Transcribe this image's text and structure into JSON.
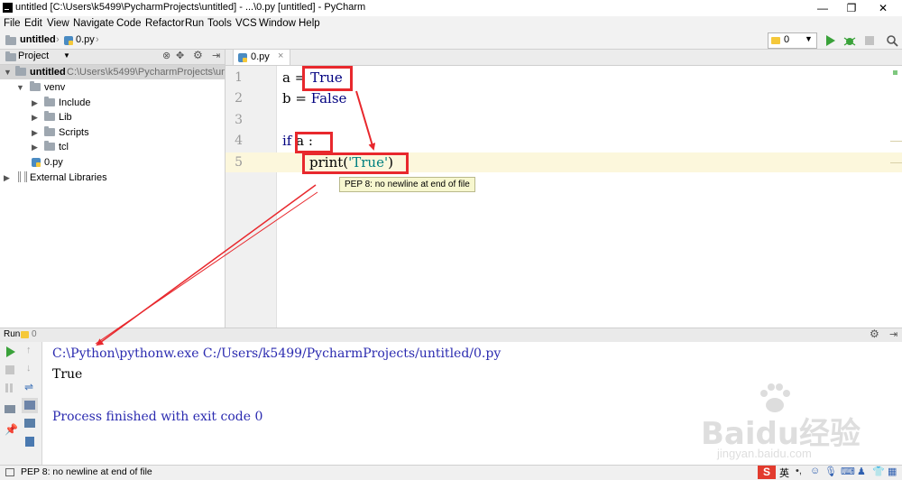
{
  "window": {
    "title": "untitled [C:\\Users\\k5499\\PycharmProjects\\untitled] - ...\\0.py [untitled] - PyCharm",
    "minimize": "—",
    "restore": "❐",
    "close": "✕"
  },
  "menu": [
    "File",
    "Edit",
    "View",
    "Navigate",
    "Code",
    "Refactor",
    "Run",
    "Tools",
    "VCS",
    "Window",
    "Help"
  ],
  "breadcrumb": {
    "project": "untitled",
    "file": "0.py"
  },
  "toolbar": {
    "run_config_value": "0"
  },
  "project_panel": {
    "title": "Project",
    "root_name": "untitled",
    "root_path": "C:\\Users\\k5499\\PycharmProjects\\untitled",
    "items": [
      {
        "label": "venv"
      },
      {
        "label": "Include"
      },
      {
        "label": "Lib"
      },
      {
        "label": "Scripts"
      },
      {
        "label": "tcl"
      },
      {
        "label": "0.py"
      },
      {
        "label": "External Libraries"
      }
    ]
  },
  "editor": {
    "tab": "0.py",
    "line_numbers": [
      "1",
      "2",
      "3",
      "4",
      "5"
    ],
    "code": {
      "l1_var": "a = ",
      "l1_kw": "True",
      "l2_var": "b = ",
      "l2_kw": "False",
      "l4_kw": "if",
      "l4_rest": " a :",
      "l5_fn": "print(",
      "l5_str": "'True'",
      "l5_close": ")"
    },
    "tooltip": "PEP 8: no newline at end of file"
  },
  "run_panel": {
    "title": "Run",
    "config": "0",
    "command": "C:\\Python\\pythonw.exe C:/Users/k5499/PycharmProjects/untitled/0.py",
    "output": "True",
    "finish": "Process finished with exit code 0"
  },
  "status_bar": {
    "message": "PEP 8: no newline at end of file"
  },
  "watermark": {
    "brand": "Baidu经验",
    "url": "jingyan.baidu.com"
  },
  "tray": {
    "ime": "英"
  },
  "colors": {
    "annotation_red": "#e8282d",
    "keyword": "#000080",
    "string": "#008080",
    "console_blue": "#2b2bb0"
  }
}
